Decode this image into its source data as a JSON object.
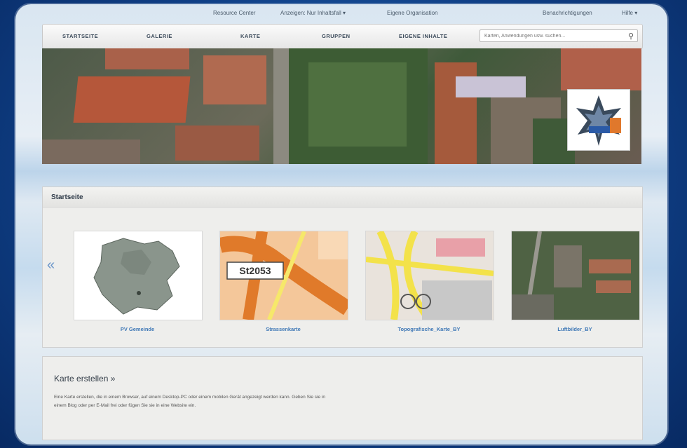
{
  "topbar": {
    "links": [
      "Resource Center",
      "Anzeigen: Nur Inhaltsfall ▾",
      "Eigene Organisation"
    ],
    "right": [
      "Benachrichtigungen",
      "Hilfe ▾"
    ]
  },
  "nav": {
    "items": [
      "STARTSEITE",
      "GALERIE",
      "KARTE",
      "GRUPPEN",
      "EIGENE INHALTE"
    ],
    "search_placeholder": "Karten, Anwendungen usw. suchen..."
  },
  "home": {
    "title": "Startseite",
    "gallery": [
      {
        "caption": "PV Gemeinde"
      },
      {
        "caption": "Strassenkarte"
      },
      {
        "caption": "Topografische_Karte_BY"
      },
      {
        "caption": "Luftbilder_BY"
      }
    ],
    "thumb_label": "St2053",
    "prev_arrow": "«",
    "next_arrow": "»"
  },
  "create": {
    "title": "Karte erstellen »",
    "text": "Eine Karte erstellen, die in einem Browser, auf einem Desktop-PC oder einem mobilen Gerät angezeigt werden kann. Geben Sie sie in einem Blog oder per E-Mail frei oder fügen Sie sie in eine Website ein."
  },
  "colors": {
    "link": "#3f78b6",
    "background": "#0f3f86"
  }
}
